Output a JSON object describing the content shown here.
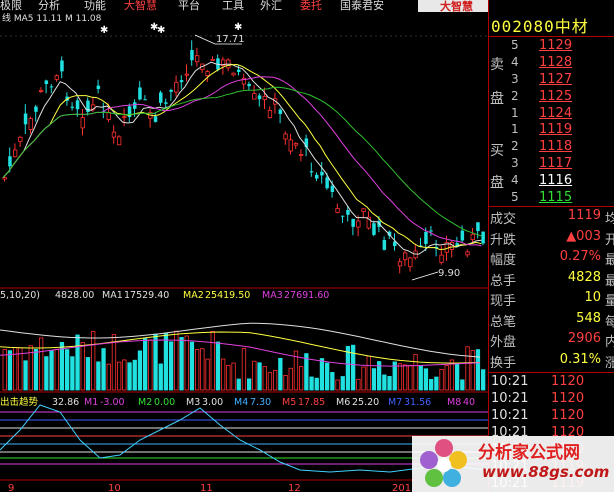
{
  "menu": [
    {
      "label": "极限",
      "highlight": false
    },
    {
      "label": "分析",
      "highlight": false
    },
    {
      "label": "功能",
      "highlight": false
    },
    {
      "label": "大智慧",
      "highlight": true
    },
    {
      "label": "平台",
      "highlight": false
    },
    {
      "label": "工具",
      "highlight": false
    },
    {
      "label": "外汇",
      "highlight": false
    },
    {
      "label": "委托",
      "highlight": true
    },
    {
      "label": "国泰君安",
      "highlight": false
    }
  ],
  "brand": "大智慧",
  "header": {
    "code_name": "002080中材",
    "ma_legend": "线 MA5 11.11  M 11.08"
  },
  "price_annotations": {
    "high": "17.71",
    "low": "9.90"
  },
  "volume_legend": [
    "5,10,20)",
    "4828.00",
    "MA1",
    "17529.40",
    "MA2",
    "25419.50",
    "MA3",
    "27691.60"
  ],
  "indicator_legend": [
    "出击趋势",
    "32.86",
    "M1",
    "-3.00",
    "M2",
    "0.00",
    "M3",
    "3.00",
    "M4",
    "7.30",
    "M5",
    "17.85",
    "M6",
    "25.20",
    "M7",
    "31.56",
    "M8",
    "40"
  ],
  "bottom_axis": [
    "9",
    "10",
    "11",
    "12",
    "201"
  ],
  "order_book": {
    "sell_label_top": "卖",
    "sell_label_bottom": "盘",
    "buy_label_top": "买",
    "buy_label_bottom": "盘",
    "sells": [
      {
        "level": "5",
        "price": "1129"
      },
      {
        "level": "4",
        "price": "1128"
      },
      {
        "level": "3",
        "price": "1127"
      },
      {
        "level": "2",
        "price": "1125"
      },
      {
        "level": "1",
        "price": "1124"
      }
    ],
    "buys": [
      {
        "level": "1",
        "price": "1119"
      },
      {
        "level": "2",
        "price": "1118"
      },
      {
        "level": "3",
        "price": "1117"
      },
      {
        "level": "4",
        "price": "1116"
      },
      {
        "level": "5",
        "price": "1115"
      }
    ]
  },
  "stats": [
    {
      "label": "成交",
      "value": "1119",
      "tail": "均",
      "color": "#ff4040"
    },
    {
      "label": "升跌",
      "value": "▲003",
      "tail": "开",
      "color": "#ff4040"
    },
    {
      "label": "幅度",
      "value": "0.27%",
      "tail": "最",
      "color": "#ff4040"
    },
    {
      "label": "总手",
      "value": "4828",
      "tail": "最",
      "color": "#ffff40"
    },
    {
      "label": "现手",
      "value": "10",
      "tail": "量",
      "color": "#ffff40"
    },
    {
      "label": "总笔",
      "value": "548",
      "tail": "每",
      "color": "#ffff40"
    },
    {
      "label": "外盘",
      "value": "2906",
      "tail": "内",
      "color": "#ff4040"
    },
    {
      "label": "换手",
      "value": "0.31%",
      "tail": "涨",
      "color": "#ffff40"
    }
  ],
  "ticks": [
    {
      "time": "10:21",
      "price": "1120"
    },
    {
      "time": "10:21",
      "price": "1120"
    },
    {
      "time": "10:21",
      "price": "1120"
    },
    {
      "time": "10:21",
      "price": "1120"
    },
    {
      "time": "10:21",
      "price": "1120"
    },
    {
      "time": "10:21",
      "price": "1119"
    },
    {
      "time": "10:21",
      "price": "1119"
    }
  ],
  "watermark": {
    "title": "分析家公式网",
    "url": "www.88gs.com"
  },
  "colors": {
    "up": "#ff3030",
    "down": "#20e0e0",
    "ma5": "#e0e0e0",
    "ma10": "#ffff40",
    "ma20": "#e040e0",
    "ma30": "#30c030"
  }
}
